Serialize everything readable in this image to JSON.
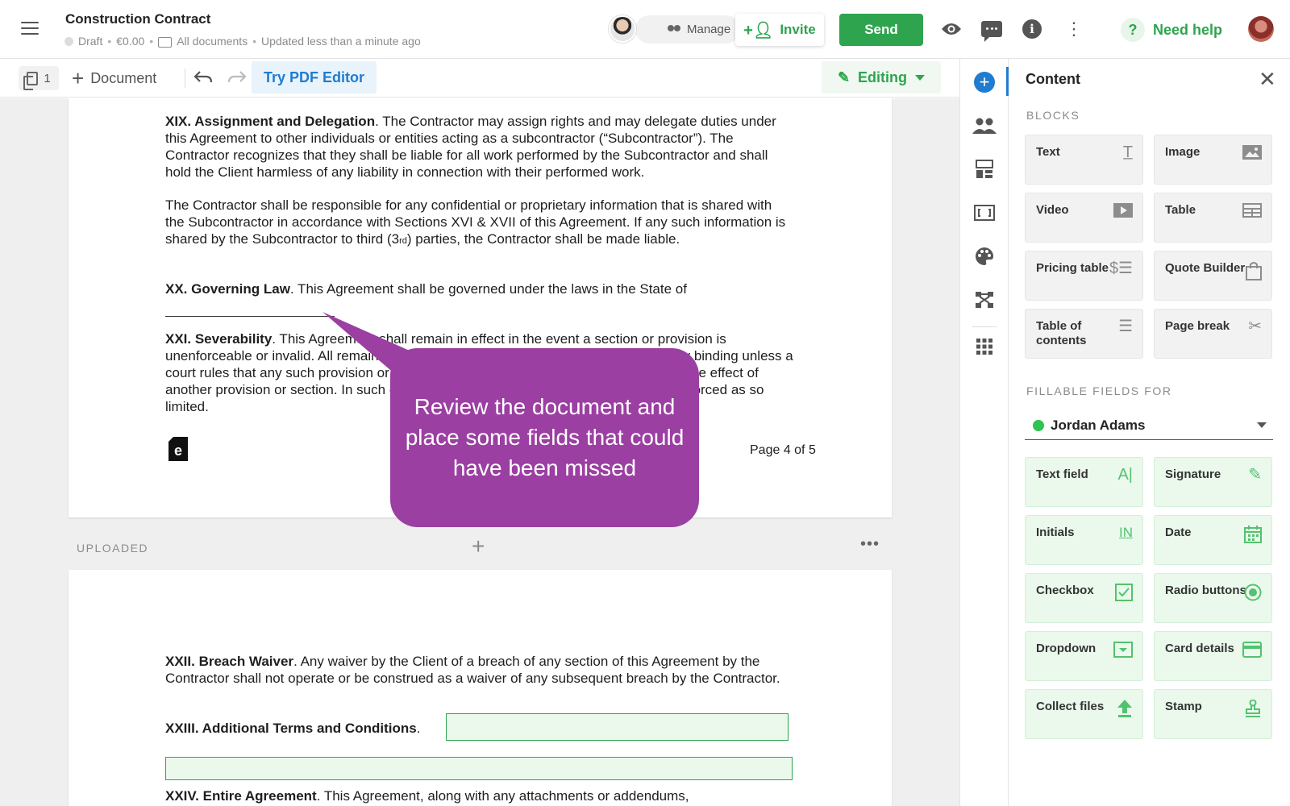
{
  "header": {
    "title": "Construction Contract",
    "status": "Draft",
    "amount": "€0.00",
    "location": "All documents",
    "updated": "Updated less than a minute ago",
    "manage_label": "Manage",
    "invite_label": "Invite",
    "send_label": "Send",
    "help_label": "Need help",
    "help_icon": "?",
    "brand_green": "#2ea44f"
  },
  "toolbar": {
    "page_count": "1",
    "add_document_label": "Document",
    "pdf_editor_label": "Try PDF Editor",
    "mode_label": "Editing"
  },
  "document": {
    "page1": {
      "s19_heading": "XIX. Assignment and Delegation",
      "s19_text": ". The Contractor may assign rights and may delegate duties under this Agreement to other individuals or entities acting as a subcontractor (“Subcontractor”). The Contractor recognizes that they shall be liable for all work performed by the Subcontractor and shall hold the Client harmless of any liability in connection with their performed work.",
      "s19_p2a": "The Contractor shall be responsible for any confidential or proprietary information that is shared with the Subcontractor in accordance with Sections XVI & XVII of this Agreement. If any such information is shared by the Subcontractor to third (3",
      "s19_p2_sup": "rd",
      "s19_p2b": ") parties, the Contractor shall be made liable.",
      "s20_heading": "XX. Governing Law",
      "s20_text": ". This Agreement shall be governed under the laws in the State of",
      "s21_heading": "XXI. Severability",
      "s21_text": ". This Agreement shall remain in effect in the event a section or provision is unenforceable or invalid. All remaining sections and provisions shall be deemed legally binding unless a court rules that any such provision or section is invalid or unenforceable, thus, limiting the effect of another provision or section. In such case, the affected provision or section shall be enforced as so limited.",
      "page_number": "Page 4 of 5",
      "logo_letter": "e"
    },
    "separator_label": "UPLOADED",
    "page2": {
      "s22_heading": "XXII. Breach Waiver",
      "s22_text": ". Any waiver by the Client of a breach of any section of this Agreement by the Contractor shall not operate or be construed as a waiver of any subsequent breach by the Contractor.",
      "s23_heading": "XXIII. Additional Terms and Conditions",
      "s24_heading": "XXIV. Entire Agreement",
      "s24_text": ". This Agreement, along with any attachments or addendums,"
    }
  },
  "tooltip": {
    "text": "Review the document and place some fields that could have been missed",
    "color": "#9b3fa2"
  },
  "panel": {
    "title": "Content",
    "blocks_label": "BLOCKS",
    "blocks": [
      {
        "label": "Text",
        "icon": "text-icon"
      },
      {
        "label": "Image",
        "icon": "image-icon"
      },
      {
        "label": "Video",
        "icon": "video-icon"
      },
      {
        "label": "Table",
        "icon": "table-icon"
      },
      {
        "label": "Pricing table",
        "icon": "pricing-icon"
      },
      {
        "label": "Quote Builder",
        "icon": "bag-icon"
      },
      {
        "label": "Table of contents",
        "icon": "list-icon"
      },
      {
        "label": "Page break",
        "icon": "scissors-icon"
      }
    ],
    "fields_label": "FILLABLE FIELDS FOR",
    "recipient": "Jordan Adams",
    "fields": [
      {
        "label": "Text field",
        "icon": "text-field-icon"
      },
      {
        "label": "Signature",
        "icon": "pen-icon"
      },
      {
        "label": "Initials",
        "icon": "initials-icon"
      },
      {
        "label": "Date",
        "icon": "calendar-icon"
      },
      {
        "label": "Checkbox",
        "icon": "checkbox-icon"
      },
      {
        "label": "Radio buttons",
        "icon": "radio-icon"
      },
      {
        "label": "Dropdown",
        "icon": "dropdown-icon"
      },
      {
        "label": "Card details",
        "icon": "card-icon"
      },
      {
        "label": "Collect files",
        "icon": "upload-icon"
      },
      {
        "label": "Stamp",
        "icon": "stamp-icon"
      }
    ]
  }
}
